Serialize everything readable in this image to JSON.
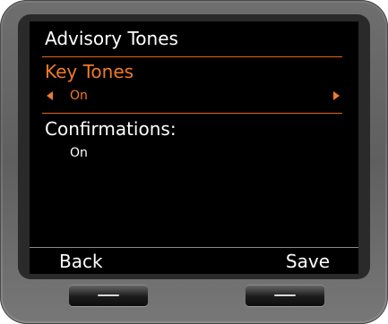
{
  "screen": {
    "title": "Advisory Tones",
    "items": [
      {
        "label": "Key Tones",
        "value": "On",
        "selected": true
      },
      {
        "label": "Confirmations:",
        "value": "On",
        "selected": false
      }
    ]
  },
  "softkeys": {
    "left": "Back",
    "right": "Save"
  },
  "colors": {
    "accent": "#f07a28",
    "screen_bg": "#000000",
    "text": "#ffffff",
    "bezel": "#6b6b6b"
  },
  "icons": {
    "arrow_left": "caret-left-icon",
    "arrow_right": "caret-right-icon",
    "softkey_dash": "dash-icon"
  }
}
